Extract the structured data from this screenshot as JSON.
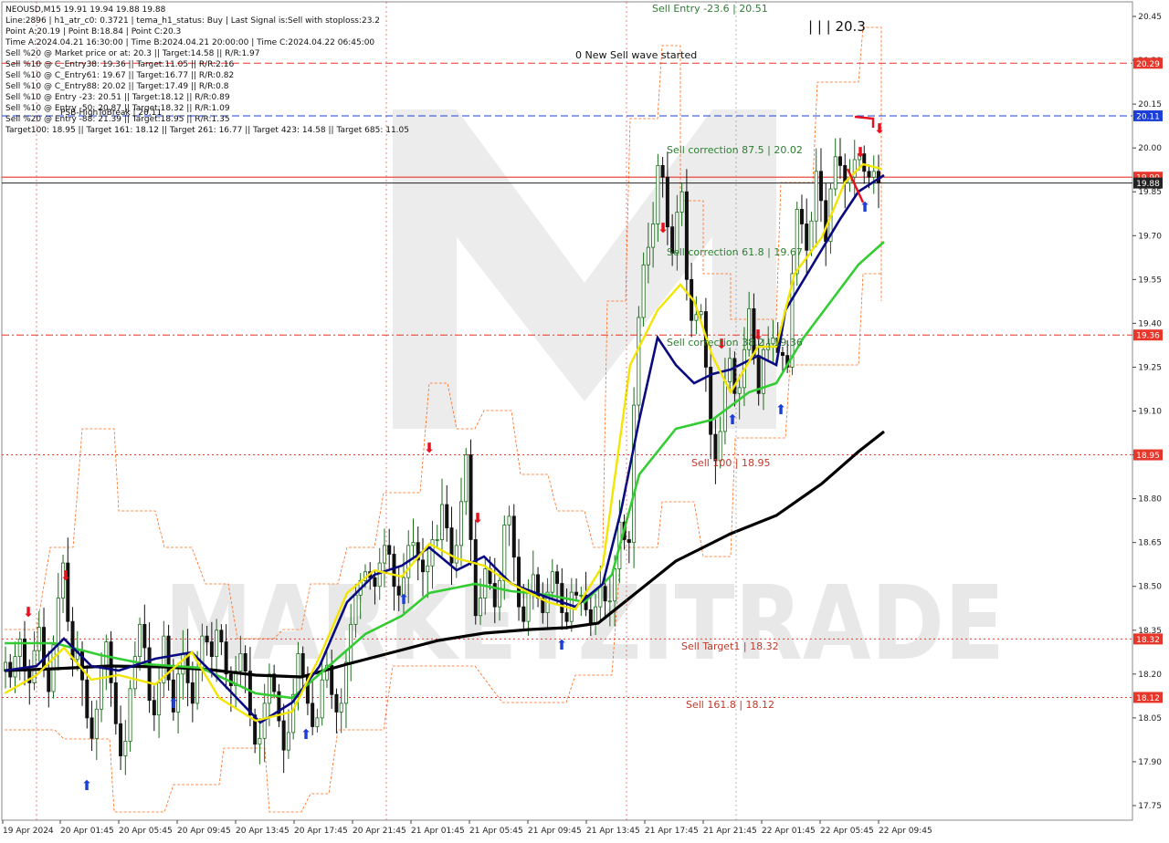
{
  "header": {
    "lines": [
      "NEOUSD,M15  19.91 19.94 19.88 19.88",
      "Line:2896  |  h1_atr_c0: 0.3721  |  tema_h1_status: Buy  |  Last Signal is:Sell with stoploss:23.2",
      "Point A:20.19  |  Point B:18.84  |  Point C:20.3",
      "Time A:2024.04.21 16:30:00  |  Time B:2024.04.21 20:00:00  |  Time C:2024.04.22 06:45:00",
      "Sell %20 @ Market price or at: 20.3  ||  Target:14.58  ||  R/R:1.97",
      "Sell %10 @ C_Entry38: 19.36  ||  Target:11.05  ||  R/R:2.16",
      "Sell %10 @ C_Entry61: 19.67  ||  Target:16.77  ||  R/R:0.82",
      "Sell %10 @ C_Entry88: 20.02  ||  Target:17.49  ||  R/R:0.8",
      "Sell %10 @ Entry -23: 20.51  ||  Target:18.12  ||  R/R:0.89",
      "Sell %10 @ Entry -50: 20.87  ||  Target:18.32  ||  R/R:1.09",
      "Sell %20 @ Entry -88: 21.39  ||  Target:18.95  ||  R/R:1.35",
      "Target100: 18.95  ||  Target 161: 18.12  ||  Target 261: 16.77  ||  Target 423: 14.58  ||  Target 685: 11.05"
    ],
    "psb_label": "PSB-HighToBreak | 20.11"
  },
  "watermark": "MARKETZITRADE",
  "annotations": {
    "sell_entry": "Sell Entry -23.6 | 20.51",
    "wave_count": "| | | 20.3",
    "new_wave": "0 New Sell wave started",
    "corr_875": "Sell correction 87.5 | 20.02",
    "corr_618": "Sell correction 61.8 | 19.67",
    "corr_382": "Sell correction 38.2 | 19.36",
    "sell_100": "Sell 100 | 18.95",
    "target1": "Sell Target1 | 18.32",
    "sell_1618": "Sell 161.8 | 18.12"
  },
  "colors": {
    "up_candle": "#1a6b1a",
    "down_candle": "#111111",
    "ema_fast": "#f2e600",
    "ema_mid": "#0a0a80",
    "ema_slow": "#33cc33",
    "ema_long": "#000000",
    "level_red": "#e8372a",
    "level_blue": "#1d3fd6",
    "envelope": "#ff6a1a"
  },
  "chart_data": {
    "type": "candlestick",
    "symbol": "NEOUSD",
    "timeframe": "M15",
    "ylim": [
      17.7,
      20.5
    ],
    "y_ticks": [
      "20.45",
      "20.30",
      "20.15",
      "20.00",
      "19.85",
      "19.70",
      "19.55",
      "19.40",
      "19.25",
      "19.10",
      "18.95",
      "18.80",
      "18.65",
      "18.50",
      "18.35",
      "18.20",
      "18.05",
      "17.90",
      "17.75"
    ],
    "x_ticks": [
      "19 Apr 2024",
      "20 Apr 01:45",
      "20 Apr 05:45",
      "20 Apr 09:45",
      "20 Apr 13:45",
      "20 Apr 17:45",
      "20 Apr 21:45",
      "21 Apr 01:45",
      "21 Apr 05:45",
      "21 Apr 09:45",
      "21 Apr 13:45",
      "21 Apr 17:45",
      "21 Apr 21:45",
      "22 Apr 01:45",
      "22 Apr 05:45",
      "22 Apr 09:45"
    ],
    "last_price": 19.88,
    "levels": [
      {
        "value": 20.29,
        "label": "20.29",
        "color": "#e8372a",
        "style": "dash"
      },
      {
        "value": 20.11,
        "label": "20.11",
        "color": "#1d3fd6",
        "style": "dash"
      },
      {
        "value": 19.9,
        "label": "19.90",
        "color": "#e8372a",
        "style": "solid"
      },
      {
        "value": 19.88,
        "label": "19.88",
        "color": "#222222",
        "style": "solid"
      },
      {
        "value": 19.36,
        "label": "19.36",
        "color": "#e8372a",
        "style": "dashdot"
      },
      {
        "value": 18.95,
        "label": "18.95",
        "color": "#e8372a",
        "style": "dot"
      },
      {
        "value": 18.32,
        "label": "18.32",
        "color": "#e8372a",
        "style": "dot"
      },
      {
        "value": 18.12,
        "label": "18.12",
        "color": "#e8372a",
        "style": "dot"
      }
    ],
    "candles_close": [
      18.24,
      18.19,
      18.26,
      18.32,
      18.21,
      18.17,
      18.28,
      18.36,
      18.22,
      18.14,
      18.3,
      18.46,
      18.58,
      18.38,
      18.25,
      18.28,
      18.18,
      18.05,
      17.98,
      18.08,
      18.23,
      18.31,
      18.17,
      18.03,
      17.92,
      17.97,
      18.15,
      18.26,
      18.37,
      18.29,
      18.11,
      18.06,
      18.17,
      18.33,
      18.18,
      18.07,
      18.2,
      18.27,
      18.17,
      18.1,
      18.22,
      18.33,
      18.31,
      18.26,
      18.35,
      18.31,
      18.2,
      18.16,
      18.21,
      18.27,
      18.21,
      18.06,
      17.96,
      17.98,
      18.1,
      18.2,
      18.14,
      18.04,
      17.94,
      18.0,
      18.13,
      18.27,
      18.19,
      18.1,
      18.02,
      18.05,
      18.18,
      18.23,
      18.13,
      18.07,
      18.1,
      18.24,
      18.37,
      18.47,
      18.52,
      18.55,
      18.53,
      18.5,
      18.58,
      18.64,
      18.61,
      18.5,
      18.47,
      18.53,
      18.64,
      18.65,
      18.59,
      18.55,
      18.57,
      18.66,
      18.66,
      18.78,
      18.7,
      18.58,
      18.64,
      18.79,
      18.95,
      18.66,
      18.4,
      18.46,
      18.56,
      18.51,
      18.43,
      18.52,
      18.71,
      18.74,
      18.6,
      18.43,
      18.38,
      18.48,
      18.54,
      18.46,
      18.41,
      18.48,
      18.55,
      18.51,
      18.41,
      18.38,
      18.48,
      18.47,
      18.47,
      18.42,
      18.37,
      18.43,
      18.5,
      18.45,
      18.45,
      18.56,
      18.72,
      18.66,
      18.65,
      19.12,
      19.42,
      19.6,
      19.66,
      19.74,
      19.94,
      19.9,
      19.73,
      19.64,
      19.78,
      19.85,
      19.55,
      19.41,
      19.43,
      19.44,
      19.25,
      19.02,
      18.93,
      19.03,
      19.2,
      19.28,
      19.16,
      19.18,
      19.31,
      19.45,
      19.29,
      19.16,
      19.31,
      19.33,
      19.35,
      19.3,
      19.29,
      19.25,
      19.57,
      19.79,
      19.74,
      19.65,
      19.75,
      19.92,
      19.82,
      19.68,
      19.86,
      19.97,
      19.94,
      19.88,
      19.9,
      19.96,
      19.98,
      19.92,
      19.9,
      19.92,
      19.88
    ]
  }
}
